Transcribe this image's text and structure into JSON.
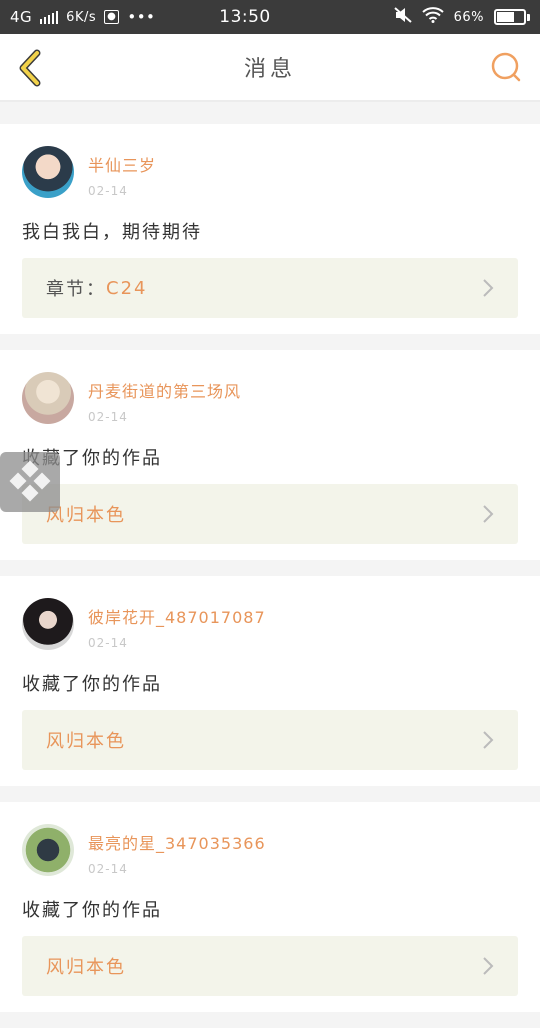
{
  "status_bar": {
    "network": "4G",
    "speed": "6K/s",
    "time": "13:50",
    "battery": "66%",
    "battery_level": 0.66,
    "extra": "•••"
  },
  "header": {
    "title": "消息",
    "accent_color": "#f0a060"
  },
  "messages": [
    {
      "username": "半仙三岁",
      "date": "02-14",
      "text": "我白我白，期待期待",
      "work_label": "章节：",
      "work_value": "C24"
    },
    {
      "username": "丹麦街道的第三场风",
      "date": "02-14",
      "text": "收藏了你的作品",
      "work_label": "",
      "work_value": "风归本色"
    },
    {
      "username": "彼岸花开_487017087",
      "date": "02-14",
      "text": "收藏了你的作品",
      "work_label": "",
      "work_value": "风归本色"
    },
    {
      "username": "最亮的星_347035366",
      "date": "02-14",
      "text": "收藏了你的作品",
      "work_label": "",
      "work_value": "风归本色"
    }
  ]
}
